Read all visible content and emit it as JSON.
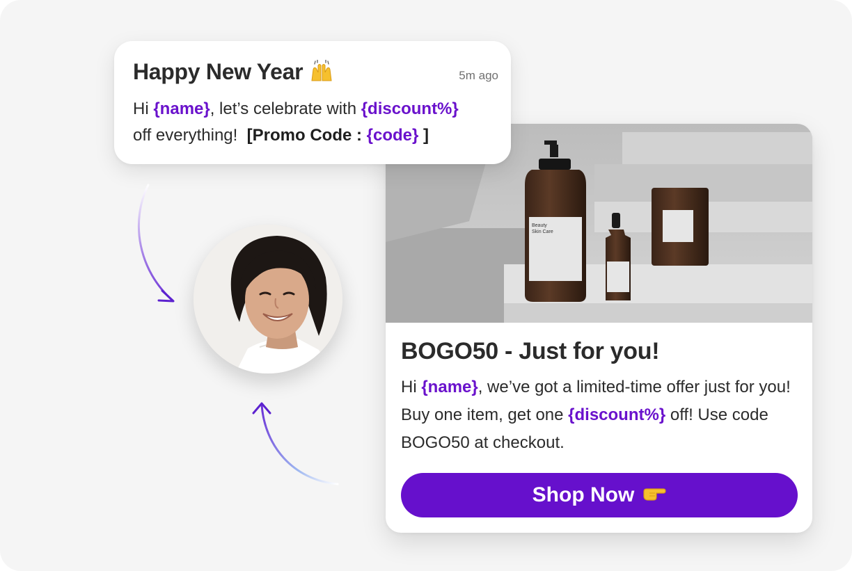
{
  "notification": {
    "title": "Happy New Year",
    "title_emoji": "raised-hands-icon",
    "time": "5m ago",
    "text_hi": "Hi ",
    "var_name": "{name}",
    "text_mid": ", let’s celebrate with ",
    "var_discount": "{discount%}",
    "text_off": "off everything!",
    "promo_open": "[Promo Code : ",
    "var_code": "{code}",
    "promo_close": " ]"
  },
  "promo_card": {
    "image_alt": "Beauty Skin Care product bottles",
    "product_label": "Beauty Skin Care",
    "title": "BOGO50 - Just for you!",
    "text_hi": "Hi ",
    "var_name": "{name}",
    "text_mid": ", we’ve got a limited-time offer just for you! Buy one item, get one ",
    "var_discount": "{discount%}",
    "text_end": " off! Use code BOGO50 at checkout.",
    "button_label": "Shop Now",
    "button_emoji": "pointing-hand-icon"
  },
  "colors": {
    "accent": "#6610cc",
    "variable": "#6a12cc",
    "background": "#f5f5f5"
  }
}
